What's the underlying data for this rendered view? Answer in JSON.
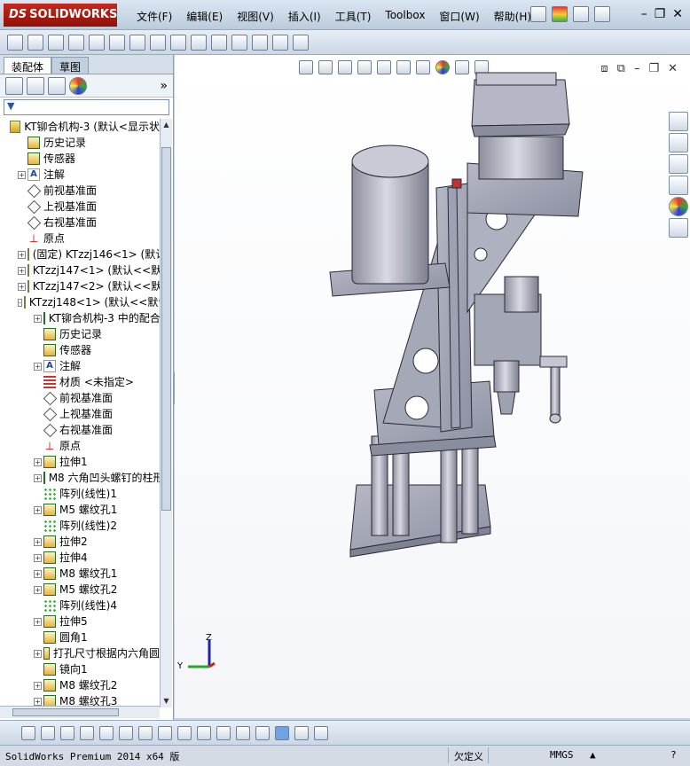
{
  "app": {
    "logo": "SOLIDWORKS",
    "logo_prefix": "DS"
  },
  "menu": [
    "文件(F)",
    "编辑(E)",
    "视图(V)",
    "插入(I)",
    "工具(T)",
    "Toolbox",
    "窗口(W)",
    "帮助(H)"
  ],
  "tabs": [
    "装配体",
    "草图"
  ],
  "tree": [
    {
      "label": "KT铆合机构-3  (默认<显示状",
      "level": 0,
      "exp": "",
      "icon": "asm"
    },
    {
      "label": "历史记录",
      "level": 1,
      "exp": "",
      "icon": "feat"
    },
    {
      "label": "传感器",
      "level": 1,
      "exp": "",
      "icon": "feat"
    },
    {
      "label": "注解",
      "level": 1,
      "exp": "+",
      "icon": "note"
    },
    {
      "label": "前视基准面",
      "level": 1,
      "exp": "",
      "icon": "plane"
    },
    {
      "label": "上视基准面",
      "level": 1,
      "exp": "",
      "icon": "plane"
    },
    {
      "label": "右视基准面",
      "level": 1,
      "exp": "",
      "icon": "plane"
    },
    {
      "label": "原点",
      "level": 1,
      "exp": "",
      "icon": "origin"
    },
    {
      "label": "(固定) KTzzj146<1> (默认",
      "level": 1,
      "exp": "+",
      "icon": "asm"
    },
    {
      "label": "KTzzj147<1> (默认<<默认",
      "level": 1,
      "exp": "+",
      "icon": "asm"
    },
    {
      "label": "KTzzj147<2> (默认<<默认",
      "level": 1,
      "exp": "+",
      "icon": "asm"
    },
    {
      "label": "KTzzj148<1> (默认<<默认",
      "level": 1,
      "exp": "-",
      "icon": "asm"
    },
    {
      "label": "KT铆合机构-3 中的配合",
      "level": 2,
      "exp": "+",
      "icon": "feat"
    },
    {
      "label": "历史记录",
      "level": 2,
      "exp": "",
      "icon": "feat"
    },
    {
      "label": "传感器",
      "level": 2,
      "exp": "",
      "icon": "feat"
    },
    {
      "label": "注解",
      "level": 2,
      "exp": "+",
      "icon": "note"
    },
    {
      "label": "材质 <未指定>",
      "level": 2,
      "exp": "",
      "icon": "mat"
    },
    {
      "label": "前视基准面",
      "level": 2,
      "exp": "",
      "icon": "plane"
    },
    {
      "label": "上视基准面",
      "level": 2,
      "exp": "",
      "icon": "plane"
    },
    {
      "label": "右视基准面",
      "level": 2,
      "exp": "",
      "icon": "plane"
    },
    {
      "label": "原点",
      "level": 2,
      "exp": "",
      "icon": "origin"
    },
    {
      "label": "拉伸1",
      "level": 2,
      "exp": "+",
      "icon": "feat"
    },
    {
      "label": "M8 六角凹头螺钉的柱形",
      "level": 2,
      "exp": "+",
      "icon": "feat"
    },
    {
      "label": "阵列(线性)1",
      "level": 2,
      "exp": "",
      "icon": "pat"
    },
    {
      "label": "M5 螺纹孔1",
      "level": 2,
      "exp": "+",
      "icon": "feat"
    },
    {
      "label": "阵列(线性)2",
      "level": 2,
      "exp": "",
      "icon": "pat"
    },
    {
      "label": "拉伸2",
      "level": 2,
      "exp": "+",
      "icon": "feat"
    },
    {
      "label": "拉伸4",
      "level": 2,
      "exp": "+",
      "icon": "feat"
    },
    {
      "label": "M8 螺纹孔1",
      "level": 2,
      "exp": "+",
      "icon": "feat"
    },
    {
      "label": "M5 螺纹孔2",
      "level": 2,
      "exp": "+",
      "icon": "feat"
    },
    {
      "label": "阵列(线性)4",
      "level": 2,
      "exp": "",
      "icon": "pat"
    },
    {
      "label": "拉伸5",
      "level": 2,
      "exp": "+",
      "icon": "feat"
    },
    {
      "label": "圆角1",
      "level": 2,
      "exp": "",
      "icon": "feat"
    },
    {
      "label": "打孔尺寸根据内六角圆",
      "level": 2,
      "exp": "+",
      "icon": "feat"
    },
    {
      "label": "镜向1",
      "level": 2,
      "exp": "",
      "icon": "feat"
    },
    {
      "label": "M8 螺纹孔2",
      "level": 2,
      "exp": "+",
      "icon": "feat"
    },
    {
      "label": "M8 螺纹孔3",
      "level": 2,
      "exp": "+",
      "icon": "feat"
    }
  ],
  "status": {
    "product": "SolidWorks Premium 2014 x64 版",
    "state": "欠定义",
    "units": "MMGS"
  },
  "triad": {
    "z": "Z",
    "y": "Y"
  }
}
